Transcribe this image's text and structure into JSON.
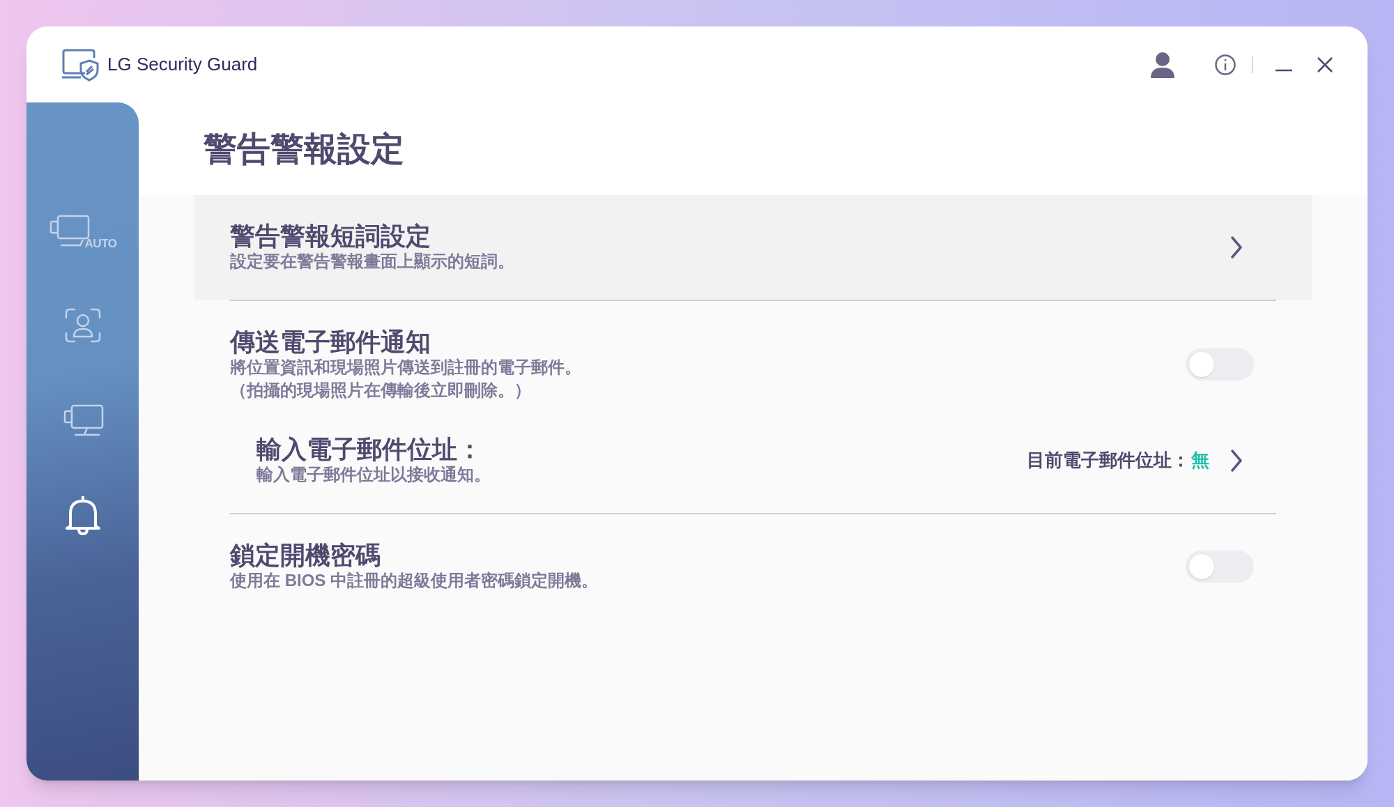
{
  "window": {
    "title": "LG Security Guard"
  },
  "sidebar": {
    "items": [
      {
        "kind": "monitor-auto",
        "label": "AUTO",
        "selected": false
      },
      {
        "kind": "face-scan",
        "selected": false
      },
      {
        "kind": "monitor",
        "selected": false
      },
      {
        "kind": "bell",
        "selected": true
      }
    ]
  },
  "page": {
    "title": "警告警報設定"
  },
  "settings": [
    {
      "kind": "link",
      "title": "警告警報短詞設定",
      "description": "設定要在警告警報畫面上顯示的短詞。",
      "highlighted": true
    },
    {
      "kind": "toggle",
      "title": "傳送電子郵件通知",
      "description": "將位置資訊和現場照片傳送到註冊的電子郵件。",
      "note": "（拍攝的現場照片在傳輸後立即刪除。）",
      "on": false,
      "sub": {
        "title": "輸入電子郵件位址：",
        "description": "輸入電子郵件位址以接收通知。",
        "current_label": "目前電子郵件位址：",
        "current_value": "無"
      }
    },
    {
      "kind": "toggle",
      "title": "鎖定開機密碼",
      "description": "使用在 BIOS 中註冊的超級使用者密碼鎖定開機。",
      "on": false
    }
  ]
}
